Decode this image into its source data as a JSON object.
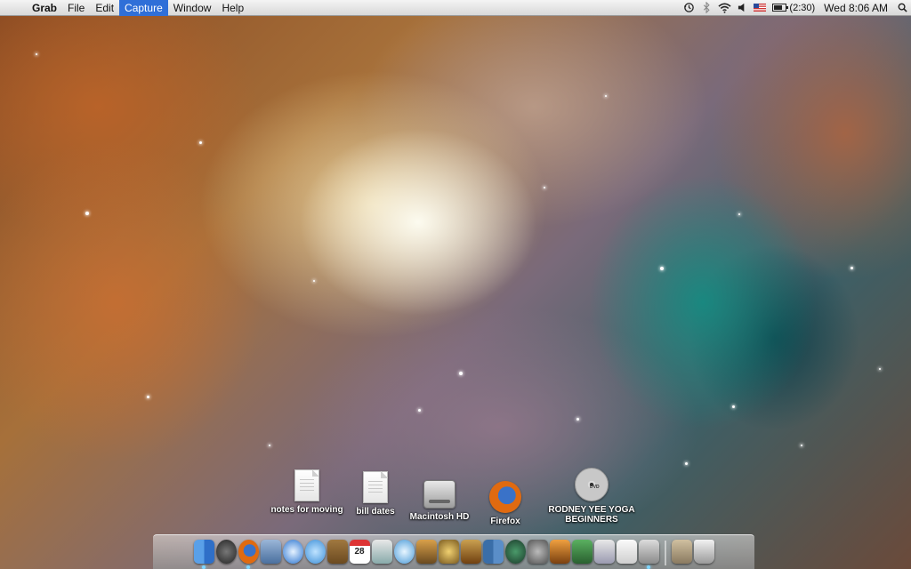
{
  "menubar": {
    "apple_glyph": "",
    "app_name": "Grab",
    "menus": [
      "File",
      "Edit",
      "Capture",
      "Window",
      "Help"
    ],
    "active_menu": "Capture",
    "battery_label": "(2:30)",
    "clock": "Wed 8:06 AM"
  },
  "desktop_icons": [
    {
      "label": "notes for moving",
      "icon": "document-icon"
    },
    {
      "label": "bill dates",
      "icon": "document-icon"
    },
    {
      "label": "Macintosh HD",
      "icon": "hard-drive-icon"
    },
    {
      "label": "Firefox",
      "icon": "firefox-icon"
    },
    {
      "label": "RODNEY YEE YOGA BEGINNERS",
      "icon": "dvd-icon"
    }
  ],
  "dock": {
    "calendar_date": "28",
    "dvd_label": "DVD",
    "items": [
      "finder-icon",
      "dashboard-icon",
      "firefox-icon",
      "mail-icon",
      "safari-icon",
      "ichat-icon",
      "address-book-icon",
      "ical-icon",
      "preview-icon",
      "itunes-icon",
      "iphoto-icon",
      "imovie-icon",
      "garageband-icon",
      "spaces-icon",
      "time-machine-icon",
      "system-preferences-icon",
      "keynote-icon",
      "numbers-icon",
      "pages-icon",
      "textedit-icon",
      "grab-icon",
      "downloads-stack-icon",
      "trash-icon"
    ]
  },
  "colors": {
    "menu_highlight": "#2f6fd8",
    "dock_indicator": "#7fd6ff"
  }
}
